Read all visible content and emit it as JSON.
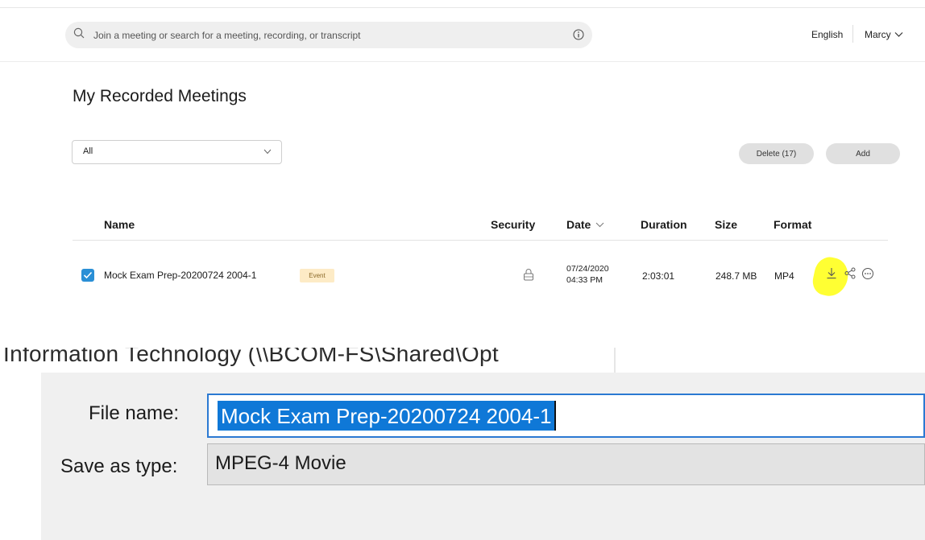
{
  "search": {
    "placeholder": "Join a meeting or search for a meeting, recording, or transcript"
  },
  "header": {
    "language": "English",
    "user": "Marcy"
  },
  "page": {
    "title": "My Recorded Meetings"
  },
  "filter": {
    "value": "All"
  },
  "actions": {
    "delete_label": "Delete (17)",
    "add_label": "Add"
  },
  "table": {
    "columns": {
      "name": "Name",
      "security": "Security",
      "date": "Date",
      "duration": "Duration",
      "size": "Size",
      "format": "Format"
    },
    "rows": [
      {
        "checked": true,
        "name": "Mock Exam Prep-20200724 2004-1",
        "badge": "Event",
        "security_icon": "lock-icon",
        "date_line1": "07/24/2020",
        "date_line2": "04:33 PM",
        "duration": "2:03:01",
        "size": "248.7 MB",
        "format": "MP4",
        "actions": [
          "download-icon",
          "share-icon",
          "more-icon"
        ]
      }
    ]
  },
  "folder_bar": {
    "text": "Information Technology (\\\\BCOM-FS\\Shared\\Opt"
  },
  "save_dialog": {
    "file_name_label": "File name:",
    "file_name_value": "Mock Exam Prep-20200724 2004-1",
    "save_type_label": "Save as type:",
    "save_type_value": "MPEG-4 Movie"
  },
  "colors": {
    "checkbox": "#2a8fd6",
    "badge_bg": "#fdebc6",
    "highlight": "#ffff33",
    "selection": "#0f78d7",
    "focus_border": "#2b79d2"
  }
}
